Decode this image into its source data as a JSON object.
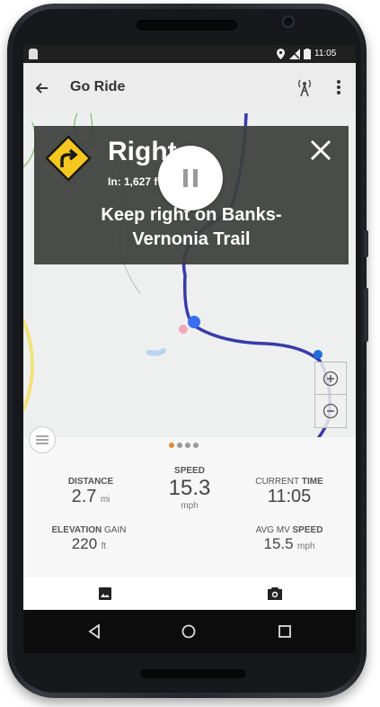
{
  "status_bar": {
    "time": "11:05"
  },
  "app_bar": {
    "title": "Go Ride",
    "back_icon": "arrow-left-icon",
    "broadcast_icon": "broadcast-antenna-icon",
    "menu_icon": "more-vertical-icon"
  },
  "turn": {
    "direction": "Right",
    "distance": "In: 1,627 ft",
    "instruction_line1": "Keep right on Banks-",
    "instruction_line2": "Vernonia Trail",
    "sign_color": "#f6c81f",
    "close_icon": "close-icon"
  },
  "map": {
    "route_color": "#3a3aa8",
    "zoom_in_icon": "zoom-in-icon",
    "zoom_out_icon": "zoom-out-icon",
    "layers_icon": "layers-icon"
  },
  "page_indicator": {
    "active_color": "#e38a3a"
  },
  "stats": {
    "distance": {
      "label": "DISTANCE",
      "value": "2.7",
      "unit": "mi"
    },
    "speed": {
      "label": "SPEED",
      "value": "15.3",
      "unit": "mph"
    },
    "current_time": {
      "label_light": "CURRENT",
      "label_bold": "TIME",
      "value": "11:05"
    },
    "elevation_gain": {
      "label_bold": "ELEVATION",
      "label_light": "GAIN",
      "value": "220",
      "unit": "ft"
    },
    "avg_speed": {
      "label_light": "AVG MV",
      "label_bold": "SPEED",
      "value": "15.5",
      "unit": "mph"
    }
  },
  "bottom_toolbar": {
    "photo_icon": "image-icon",
    "pause_icon": "pause-icon",
    "camera_icon": "camera-icon"
  },
  "nav_bar": {
    "back_icon": "nav-back-icon",
    "home_icon": "nav-home-icon",
    "recents_icon": "nav-recents-icon"
  }
}
